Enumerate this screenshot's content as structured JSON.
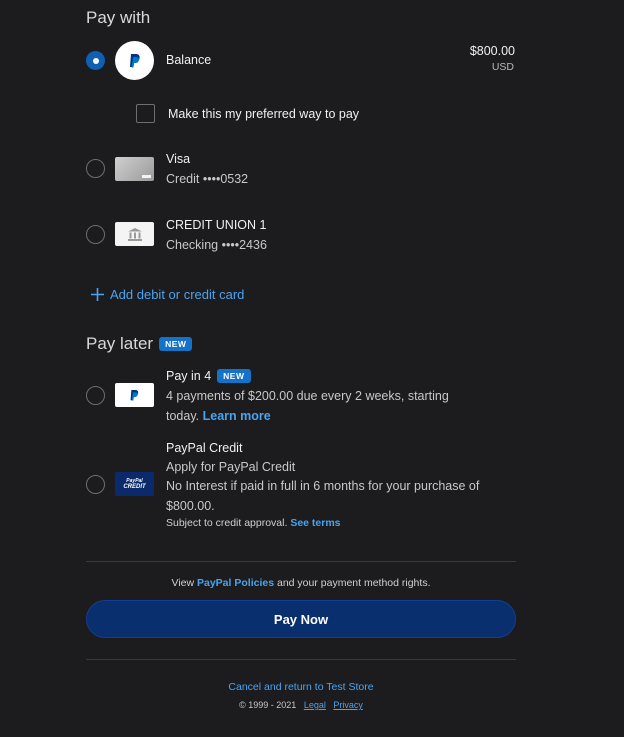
{
  "pay_with": {
    "title": "Pay with",
    "balance": {
      "label": "Balance",
      "amount": "$800.00",
      "currency": "USD"
    },
    "preferred_label": "Make this my preferred way to pay",
    "visa": {
      "title": "Visa",
      "detail": "Credit ••••0532"
    },
    "bank": {
      "title": "CREDIT UNION 1",
      "detail": "Checking ••••2436"
    },
    "add_card": "Add debit or credit card"
  },
  "pay_later": {
    "title": "Pay later",
    "badge": "NEW",
    "pay_in_4": {
      "title": "Pay in 4",
      "badge": "NEW",
      "line1": "4 payments of $200.00 due every 2 weeks, starting",
      "line2": "today.",
      "learn_more": "Learn more"
    },
    "paypal_credit": {
      "title": "PayPal Credit",
      "line1": "Apply for PayPal Credit",
      "line2": "No Interest if paid in full in 6 months for your purchase of",
      "line3": "$800.00.",
      "subject": "Subject to credit approval.",
      "see_terms": "See terms",
      "logo_top": "PayPal",
      "logo_bottom": "CREDIT"
    }
  },
  "policies": {
    "pre": "View",
    "link": "PayPal Policies",
    "post": "and your payment method rights."
  },
  "pay_now": "Pay Now",
  "footer": {
    "cancel": "Cancel and return to Test Store",
    "copyright": "© 1999 - 2021",
    "legal": "Legal",
    "privacy": "Privacy"
  },
  "colors": {
    "accent": "#4aa3f0",
    "button": "#0a2f6e",
    "radio_selected": "#0f5fb3",
    "background": "#1c1c1e"
  },
  "icons": {
    "paypal": "paypal-logo-icon",
    "plus": "plus-icon",
    "bank": "bank-icon",
    "card": "visa-card-icon"
  }
}
